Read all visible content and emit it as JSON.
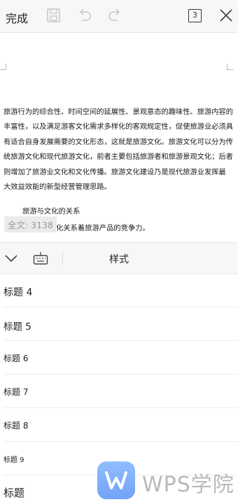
{
  "toolbar": {
    "done_label": "完成",
    "page_count": "3",
    "icons": [
      "save-icon",
      "undo-icon",
      "redo-icon",
      "close-icon"
    ]
  },
  "document": {
    "paragraph1": "旅游行为的综合性、时间空间的延展性、景观意态的趣味性、旅游内容的丰富性，以及满足游客文化需求多样化的客观规定性，促使旅游业必须具有适合自身发展需要的文化形态，这就是旅游文化。旅游文化可以分为传统旅游文化和现代旅游文化，前者主要包括旅游者和旅游景观文化；后者则增加了旅游业文化和文化传播。旅游文化建设乃是现代旅游业发挥最  大效益效能的新型经营管理思路。",
    "line2": "旅游与文化的关系",
    "line3": "化关系着旅游产品的竞争力。",
    "word_count": "全文: 3138"
  },
  "panel": {
    "title": "样式",
    "icons": [
      "chevron-down-icon",
      "keyboard-icon"
    ]
  },
  "styles": [
    {
      "label": "标题 4"
    },
    {
      "label": "标题 5"
    },
    {
      "label": "标题 6"
    },
    {
      "label": "标题 7"
    },
    {
      "label": "标题 8"
    },
    {
      "label": "标题 9"
    },
    {
      "label": "标题"
    }
  ],
  "watermark": {
    "text": "WPS学院"
  },
  "colors": {
    "watermark_blue": "#5b92f7",
    "toolbar_bg": "#f7f7f7"
  }
}
